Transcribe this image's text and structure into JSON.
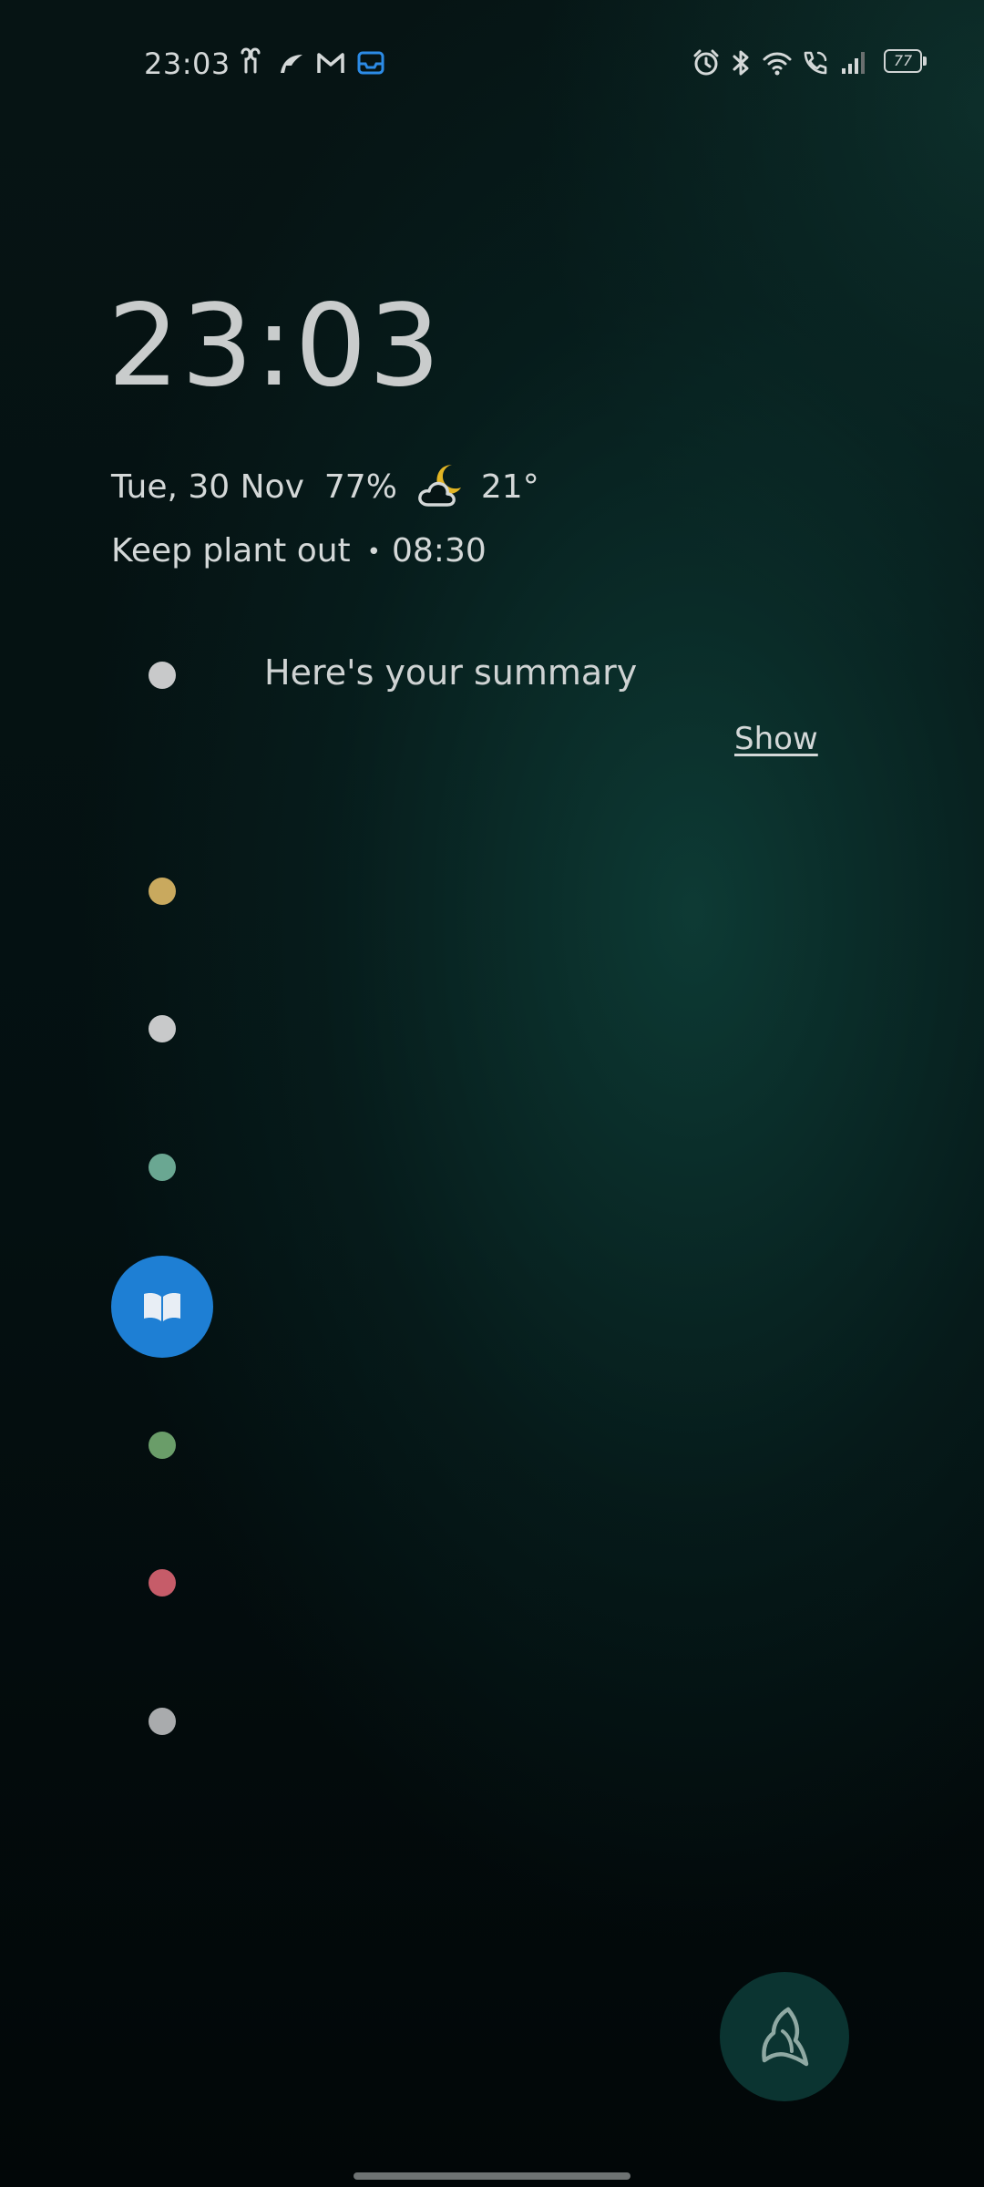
{
  "status_bar": {
    "time": "23:03",
    "left_icons": [
      "earbuds-icon",
      "feather-app-icon",
      "gmail-icon",
      "inbox-icon"
    ],
    "right_icons": [
      "alarm-icon",
      "bluetooth-icon",
      "wifi-icon",
      "wifi-calling-icon",
      "signal-icon"
    ],
    "battery_level": "77"
  },
  "lockscreen": {
    "clock": "23:03",
    "date": "Tue, 30 Nov",
    "battery_percent": "77%",
    "weather_icon": "cloud-moon-icon",
    "temperature": "21°",
    "reminder": "Keep plant out",
    "reminder_bullet": "•",
    "reminder_time": "08:30"
  },
  "summary": {
    "title": "Here's your summary",
    "action": "Show"
  },
  "notification_dots": [
    {
      "name": "dot-white",
      "color": "#c8c9ca"
    },
    {
      "name": "dot-yellow",
      "color": "#c9a95e"
    },
    {
      "name": "dot-white-2",
      "color": "#c8c9ca"
    },
    {
      "name": "dot-teal",
      "color": "#6aa792"
    },
    {
      "name": "dot-green",
      "color": "#6a9d69"
    },
    {
      "name": "dot-red",
      "color": "#c65c69"
    },
    {
      "name": "dot-grey",
      "color": "#a9abad"
    }
  ],
  "active_notification": {
    "icon": "book-icon",
    "color": "#1e7fd4"
  },
  "shortcut": {
    "icon": "app-shortcut-icon",
    "color": "#0b3431"
  }
}
